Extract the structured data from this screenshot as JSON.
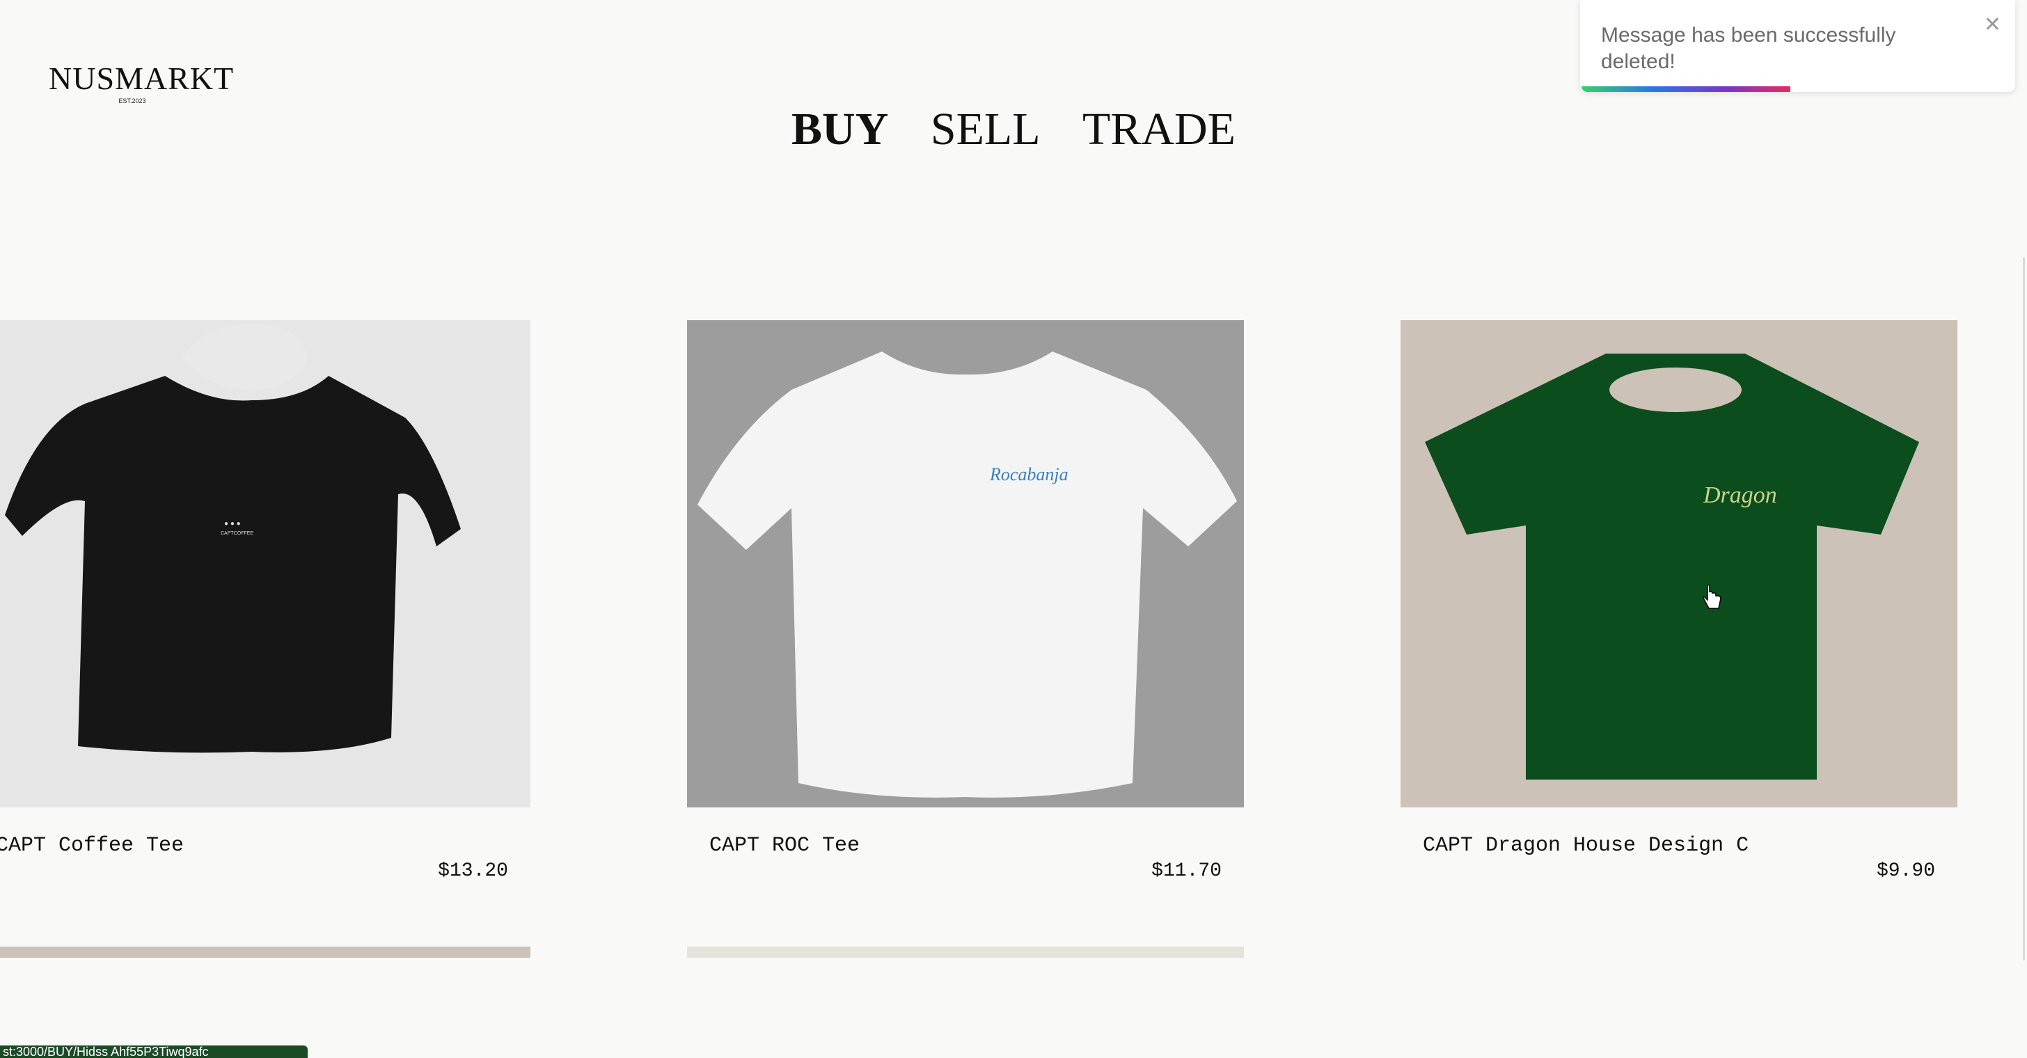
{
  "header": {
    "logo_text": "NUSMARKT",
    "logo_subtext": "EST.2023",
    "nav": [
      "BUY",
      "SELL",
      "TRADE"
    ],
    "active_nav": "BUY"
  },
  "products": [
    {
      "title": "CAPT Coffee Tee",
      "price": "$13.20",
      "image_bg": "#e6e6e6",
      "shirt_color": "#161616",
      "print_text": "CAPTCOFFEE",
      "image": "black-tshirt"
    },
    {
      "title": "CAPT ROC Tee",
      "price": "$11.70",
      "image_bg": "#9d9d9d",
      "shirt_color": "#f4f4f4",
      "print_text": "Rocabanja",
      "image": "white-tshirt"
    },
    {
      "title": "CAPT Dragon House Design C",
      "price": "$9.90",
      "image_bg": "#cdc2b7",
      "shirt_color": "#0c4d1e",
      "print_text": "Dragon",
      "image": "green-tshirt"
    }
  ],
  "toast": {
    "message": "Message has been successfully deleted!",
    "close_icon": "close-icon",
    "progress_fraction": 0.48
  },
  "status_url": "st:3000/BUY/Hidss Ahf55P3Tiwq9afc"
}
